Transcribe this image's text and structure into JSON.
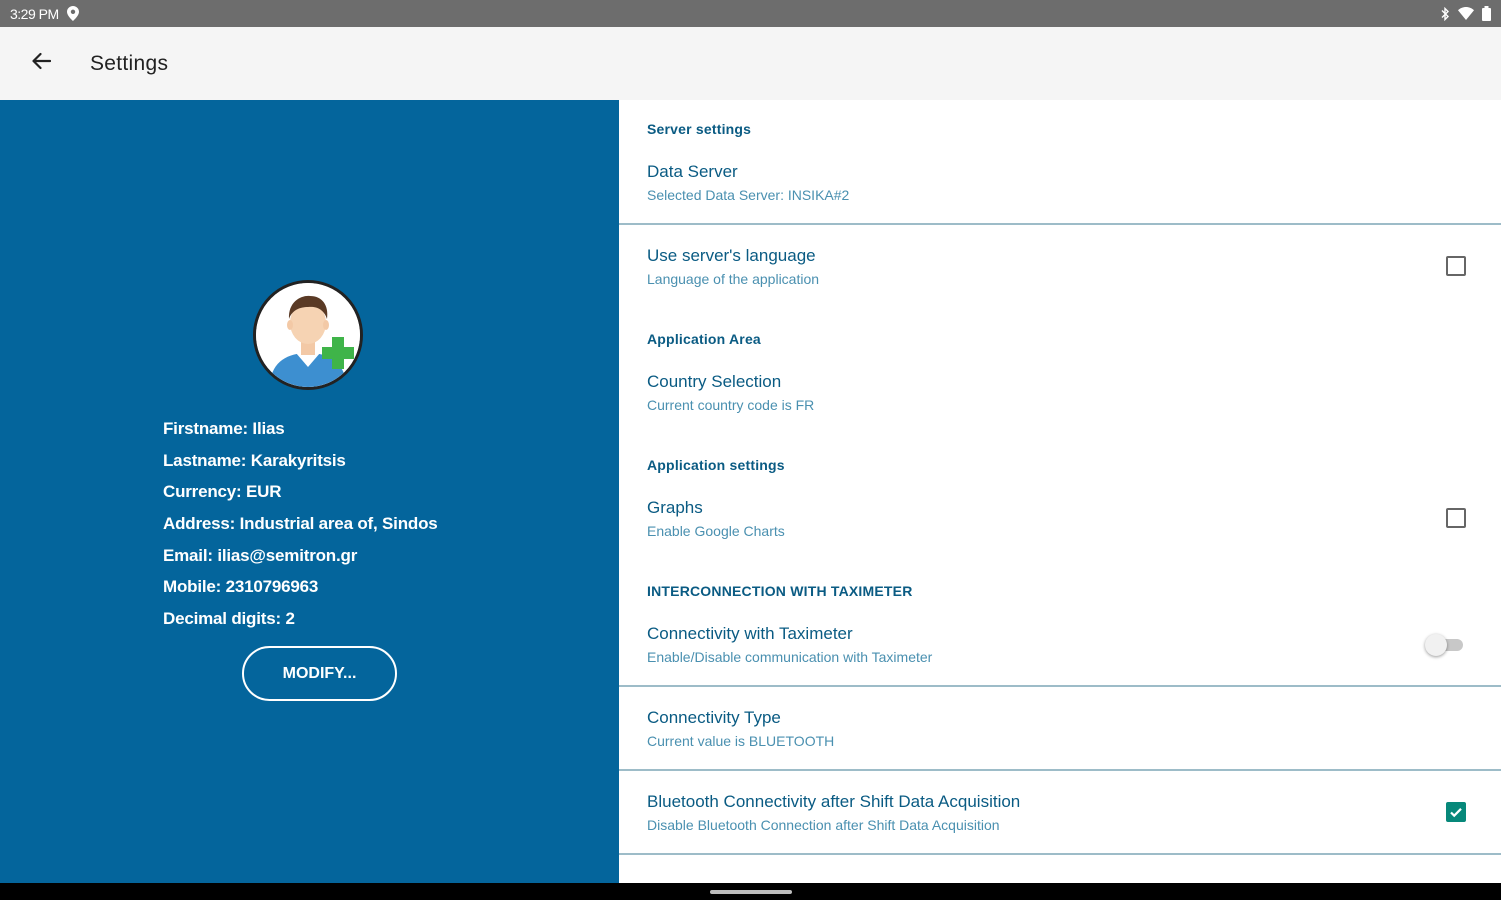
{
  "status_bar": {
    "time": "3:29 PM",
    "icons": [
      "location-icon",
      "bluetooth-icon",
      "wifi-icon",
      "battery-icon"
    ]
  },
  "app_bar": {
    "back_icon": "arrow-left-icon",
    "title": "Settings"
  },
  "profile": {
    "avatar_icon": "add-user-avatar-icon",
    "lines": [
      "Firstname: Ilias",
      "Lastname: Karakyritsis",
      "Currency: EUR",
      "Address: Industrial area of, Sindos",
      "Email: ilias@semitron.gr",
      "Mobile: 2310796963",
      "Decimal digits: 2"
    ],
    "modify_label": "MODIFY..."
  },
  "settings": {
    "server_category": "Server settings",
    "data_server": {
      "title": "Data Server",
      "summary": "Selected Data Server: INSIKA#2"
    },
    "use_server_language": {
      "title": "Use server's language",
      "summary": "Language of the application",
      "checked": false
    },
    "area_category": "Application Area",
    "country_selection": {
      "title": "Country Selection",
      "summary": "Current country code is FR"
    },
    "app_settings_category": "Application settings",
    "graphs": {
      "title": "Graphs",
      "summary": "Enable Google Charts",
      "checked": false
    },
    "taximeter_category": "INTERCONNECTION WITH TAXIMETER",
    "connectivity_taximeter": {
      "title": "Connectivity with Taximeter",
      "summary": "Enable/Disable communication with Taximeter",
      "enabled": false
    },
    "connectivity_type": {
      "title": "Connectivity Type",
      "summary": "Current value is BLUETOOTH"
    },
    "bluetooth_after_shift": {
      "title": "Bluetooth Connectivity after Shift Data Acquisition",
      "summary": "Disable Bluetooth Connection after Shift Data Acquisition",
      "checked": true
    }
  },
  "colors": {
    "left_panel": "#04659c",
    "accent_text": "#0a5b83",
    "checkbox_checked": "#07887a"
  }
}
